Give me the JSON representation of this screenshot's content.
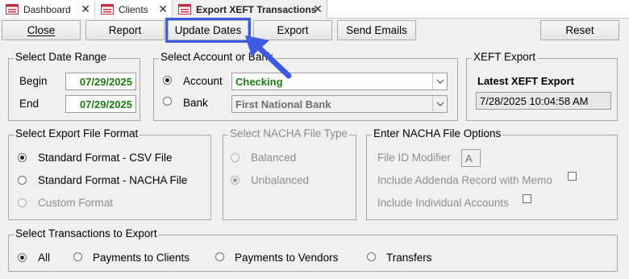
{
  "tabs": [
    {
      "label": "Dashboard",
      "close": "✕"
    },
    {
      "label": "Clients",
      "close": "✕"
    },
    {
      "label": "Export XEFT Transactions",
      "close": "✕"
    }
  ],
  "toolbar": {
    "close": "Close",
    "report": "Report",
    "update_dates": "Update Dates",
    "export": "Export",
    "send_emails": "Send Emails",
    "reset": "Reset"
  },
  "date_range": {
    "title": "Select Date Range",
    "begin_label": "Begin",
    "begin_value": "07/29/2025",
    "end_label": "End",
    "end_value": "07/29/2025"
  },
  "account": {
    "title": "Select Account or Bank",
    "account_label": "Account",
    "account_value": "Checking",
    "bank_label": "Bank",
    "bank_value": "First National Bank"
  },
  "xeft": {
    "title": "XEFT Export",
    "latest_label": "Latest XEFT Export",
    "latest_value": "7/28/2025 10:04:58 AM"
  },
  "file_format": {
    "title": "Select Export File Format",
    "options": [
      "Standard Format - CSV File",
      "Standard Format - NACHA File",
      "Custom Format"
    ]
  },
  "nacha_type": {
    "title": "Select NACHA File Type",
    "options": [
      "Balanced",
      "Unbalanced"
    ]
  },
  "nacha_options": {
    "title": "Enter NACHA File Options",
    "file_id_label": "File ID Modifier",
    "file_id_value": "A",
    "addenda_label": "Include Addenda Record with Memo",
    "individual_label": "Include Individual Accounts"
  },
  "transactions": {
    "title": "Select Transactions to Export",
    "options": [
      "All",
      "Payments to Clients",
      "Payments to Vendors",
      "Transfers"
    ]
  },
  "colors": {
    "highlight": "#3d5ae0",
    "value_green": "#1e7a14",
    "tab_icon": "#c0304a"
  }
}
